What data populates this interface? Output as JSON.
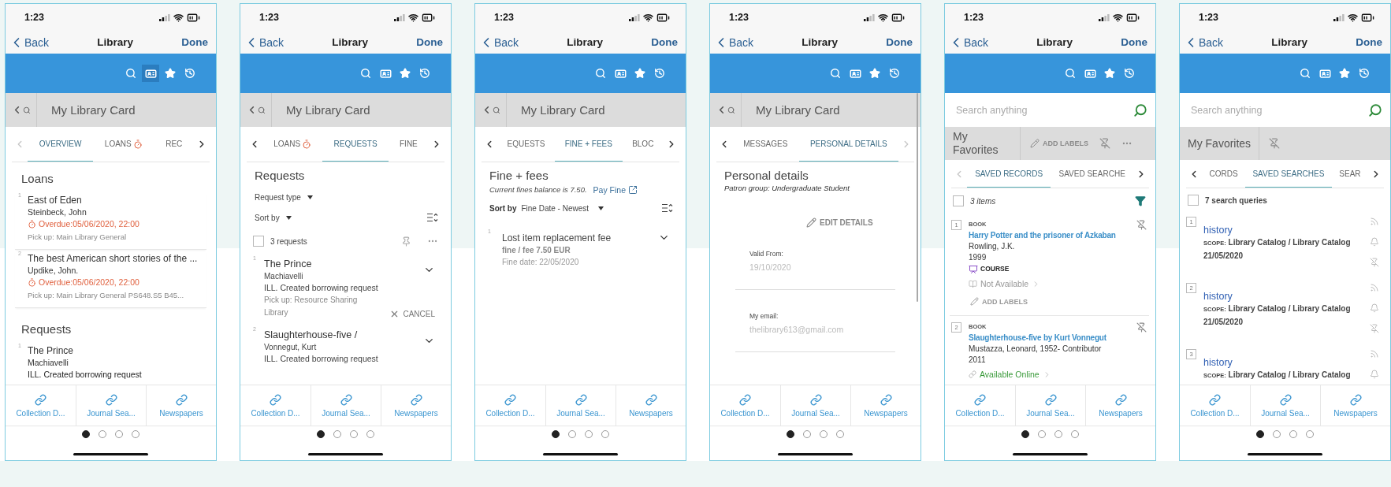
{
  "screens": [
    {
      "time": "1:23",
      "nav": {
        "back": "Back",
        "title": "Library",
        "done": "Done"
      },
      "toolbar": [
        {
          "selected": false
        },
        {
          "selected": true
        },
        {
          "selected": false
        },
        {
          "selected": false
        }
      ],
      "header": {
        "kind": "card",
        "title": "My Library Card"
      },
      "tabs": {
        "prev_disabled": true,
        "next_disabled": false,
        "items": [
          {
            "label": "OVERVIEW",
            "selected": true,
            "alert": false
          },
          {
            "label": "LOANS",
            "selected": false,
            "alert": true
          },
          {
            "label": "REC",
            "selected": false,
            "alert": false
          }
        ]
      },
      "content": {
        "kind": "overview",
        "sections": [
          {
            "title": "Loans",
            "items": [
              {
                "index": "1",
                "title": "East of Eden",
                "author": "Steinbeck, John",
                "overdue": "Overdue:05/06/2020, 22:00",
                "pickup": "Pick up: Main Library General"
              },
              {
                "index": "2",
                "title": "The best American short stories of the ...",
                "author": "Updike, John.",
                "overdue": "Overdue:05/06/2020, 22:00",
                "pickup": "Pick up: Main Library General PS648.S5 B45..."
              }
            ]
          },
          {
            "title": "Requests",
            "items": [
              {
                "index": "1",
                "title": "The Prince",
                "author": "Machiavelli",
                "status": "ILL. Created borrowing request"
              }
            ]
          }
        ]
      },
      "links": [
        "Collection D...",
        "Journal Sea...",
        "Newspapers"
      ],
      "pages": [
        {
          "selected": true
        },
        {
          "selected": false
        },
        {
          "selected": false
        },
        {
          "selected": false
        }
      ]
    },
    {
      "time": "1:23",
      "nav": {
        "back": "Back",
        "title": "Library",
        "done": "Done"
      },
      "toolbar": [
        {
          "selected": false
        },
        {
          "selected": false
        },
        {
          "selected": false
        },
        {
          "selected": false
        }
      ],
      "header": {
        "kind": "card",
        "title": "My Library Card"
      },
      "tabs": {
        "prev_disabled": false,
        "next_disabled": false,
        "items": [
          {
            "label": "LOANS",
            "selected": false,
            "alert": true
          },
          {
            "label": "REQUESTS",
            "selected": true,
            "alert": false
          },
          {
            "label": "FINE",
            "selected": false,
            "alert": false
          }
        ]
      },
      "content": {
        "kind": "requests",
        "title": "Requests",
        "filters": [
          "Request type",
          "Sort by"
        ],
        "checked": false,
        "count": "3 requests",
        "items": [
          {
            "index": "1",
            "title": "The Prince",
            "author": "Machiavelli",
            "status": "ILL. Created borrowing request",
            "pickup": "Pick up: Resource Sharing Library",
            "action": "CANCEL"
          },
          {
            "index": "2",
            "title": "Slaughterhouse-five /",
            "author": "Vonnegut, Kurt",
            "status": "ILL. Created borrowing request"
          }
        ]
      },
      "links": [
        "Collection D...",
        "Journal Sea...",
        "Newspapers"
      ],
      "pages": [
        {
          "selected": true
        },
        {
          "selected": false
        },
        {
          "selected": false
        },
        {
          "selected": false
        }
      ]
    },
    {
      "time": "1:23",
      "nav": {
        "back": "Back",
        "title": "Library",
        "done": "Done"
      },
      "toolbar": [
        {
          "selected": false
        },
        {
          "selected": false
        },
        {
          "selected": false
        },
        {
          "selected": false
        }
      ],
      "header": {
        "kind": "card",
        "title": "My Library Card"
      },
      "tabs": {
        "prev_disabled": false,
        "next_disabled": false,
        "items": [
          {
            "label": "EQUESTS",
            "selected": false,
            "alert": false
          },
          {
            "label": "FINE + FEES",
            "selected": true,
            "alert": false
          },
          {
            "label": "BLOC",
            "selected": false,
            "alert": false
          }
        ]
      },
      "content": {
        "kind": "fines",
        "title": "Fine + fees",
        "balance": "Current fines balance is 7.50.",
        "pay": "Pay Fine",
        "sort_label": "Sort by",
        "sort_value": "Fine Date - Newest",
        "items": [
          {
            "index": "1",
            "title": "Lost item replacement fee",
            "amount": "fine / fee 7.50 EUR",
            "date": "Fine date: 22/05/2020"
          }
        ]
      },
      "links": [
        "Collection D...",
        "Journal Sea...",
        "Newspapers"
      ],
      "pages": [
        {
          "selected": true
        },
        {
          "selected": false
        },
        {
          "selected": false
        },
        {
          "selected": false
        }
      ]
    },
    {
      "time": "1:23",
      "nav": {
        "back": "Back",
        "title": "Library",
        "done": "Done"
      },
      "toolbar": [
        {
          "selected": false
        },
        {
          "selected": false
        },
        {
          "selected": false
        },
        {
          "selected": false
        }
      ],
      "header": {
        "kind": "card",
        "title": "My Library Card"
      },
      "tabs": {
        "prev_disabled": false,
        "next_disabled": true,
        "items": [
          {
            "label": "MESSAGES",
            "selected": false,
            "alert": false
          },
          {
            "label": "PERSONAL DETAILS",
            "selected": true,
            "alert": false
          }
        ]
      },
      "content": {
        "kind": "details",
        "title": "Personal details",
        "subtitle": "Patron group: Undergraduate Student",
        "edit": "EDIT DETAILS",
        "fields": [
          {
            "label": "Valid From:",
            "value": "19/10/2020"
          },
          {
            "label": "My email:",
            "value": "thelibrary613@gmail.com"
          }
        ]
      },
      "links": [
        "Collection D...",
        "Journal Sea...",
        "Newspapers"
      ],
      "pages": [
        {
          "selected": true
        },
        {
          "selected": false
        },
        {
          "selected": false
        },
        {
          "selected": false
        }
      ]
    },
    {
      "time": "1:23",
      "nav": {
        "back": "Back",
        "title": "Library",
        "done": "Done"
      },
      "toolbar": [
        {
          "selected": false
        },
        {
          "selected": false
        },
        {
          "selected": false
        },
        {
          "selected": false
        }
      ],
      "header": {
        "kind": "favorites",
        "placeholder": "Search anything",
        "title": "My Favorites",
        "add_labels": "ADD LABELS",
        "disabled": true
      },
      "tabs": {
        "prev_disabled": true,
        "next_disabled": false,
        "items": [
          {
            "label": "SAVED RECORDS",
            "selected": true,
            "alert": false
          },
          {
            "label": "SAVED SEARCHE",
            "selected": false,
            "alert": false
          }
        ]
      },
      "content": {
        "kind": "records",
        "checked": false,
        "count": "3 items",
        "items": [
          {
            "index": "1",
            "type": "BOOK",
            "title": "Harry Potter and the prisoner of Azkaban",
            "author": "Rowling, J.K.",
            "year": "1999",
            "course": "COURSE",
            "availability": "Not Available",
            "available": false,
            "add_labels": "ADD LABELS"
          },
          {
            "index": "2",
            "type": "BOOK",
            "title": "Slaughterhouse-five by Kurt Vonnegut",
            "author": "Mustazza, Leonard, 1952- Contributor",
            "year": "2011",
            "availability": "Available Online",
            "available": true
          }
        ]
      },
      "links": [
        "Collection D...",
        "Journal Sea...",
        "Newspapers"
      ],
      "pages": [
        {
          "selected": true
        },
        {
          "selected": false
        },
        {
          "selected": false
        },
        {
          "selected": false
        }
      ]
    },
    {
      "time": "1:23",
      "nav": {
        "back": "Back",
        "title": "Library",
        "done": "Done"
      },
      "toolbar": [
        {
          "selected": false
        },
        {
          "selected": false
        },
        {
          "selected": false
        },
        {
          "selected": false
        }
      ],
      "header": {
        "kind": "favorites",
        "placeholder": "Search anything",
        "title": "My Favorites",
        "disabled": true
      },
      "tabs": {
        "prev_disabled": false,
        "next_disabled": false,
        "items": [
          {
            "label": "CORDS",
            "selected": false,
            "alert": false
          },
          {
            "label": "SAVED SEARCHES",
            "selected": true,
            "alert": false
          },
          {
            "label": "SEAR",
            "selected": false,
            "alert": false
          }
        ]
      },
      "content": {
        "kind": "searches",
        "checked": false,
        "count": "7 search queries",
        "items": [
          {
            "index": "1",
            "query": "history",
            "scope_label": "SCOPE:",
            "scope": "Library Catalog / Library Catalog",
            "date": "21/05/2020"
          },
          {
            "index": "2",
            "query": "history",
            "scope_label": "SCOPE:",
            "scope": "Library Catalog / Library Catalog",
            "date": "21/05/2020"
          },
          {
            "index": "3",
            "query": "history",
            "scope_label": "SCOPE:",
            "scope": "Library Catalog / Library Catalog"
          }
        ]
      },
      "links": [
        "Collection D...",
        "Journal Sea...",
        "Newspapers"
      ],
      "pages": [
        {
          "selected": true
        },
        {
          "selected": false
        },
        {
          "selected": false
        },
        {
          "selected": false
        }
      ]
    }
  ]
}
